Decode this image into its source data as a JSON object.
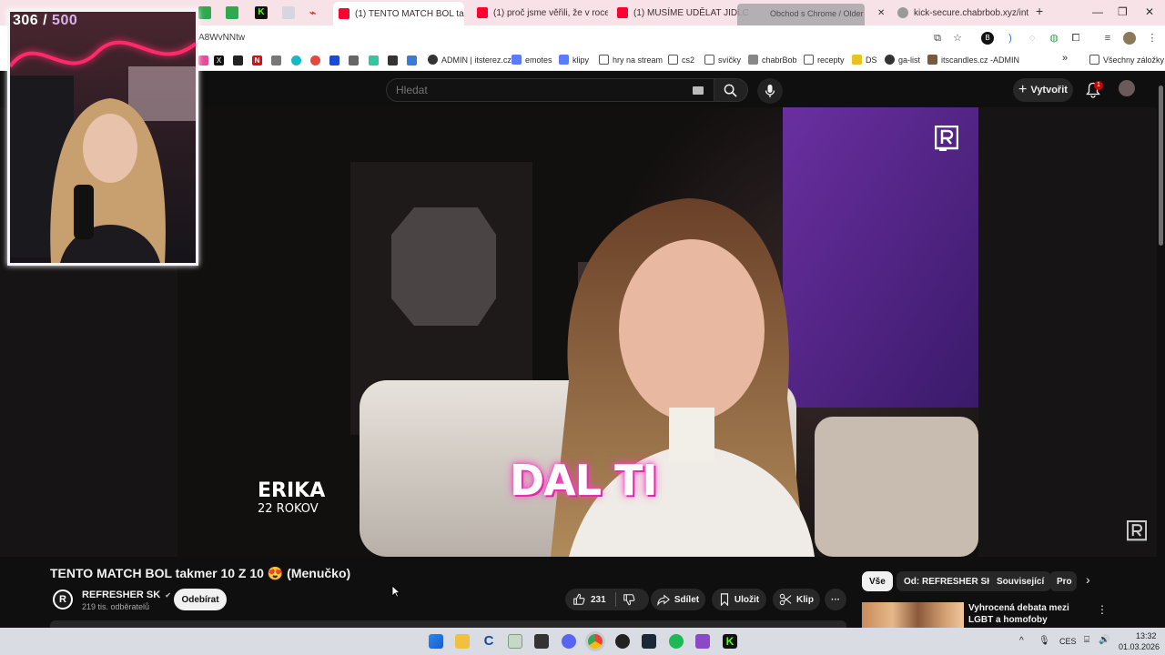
{
  "browser": {
    "tabs": [
      {
        "label": "",
        "color": "#2fa84f"
      },
      {
        "label": "",
        "color": "#2fa84f"
      },
      {
        "label": "",
        "color": "#53fc18"
      },
      {
        "label": "",
        "color": "#b8b8c8"
      },
      {
        "label": "",
        "color": "#d43a3a"
      },
      {
        "label": "(1) TENTO MATCH BOL ta",
        "color": "#ff0033"
      },
      {
        "label": "(1) proč jsme věřili, že v roce",
        "color": "#ff0033"
      },
      {
        "label": "(1) MUSÍME UDĚLAT JIDLO N",
        "color": "#ff0033"
      },
      {
        "label": "Obchod",
        "color": "#888888"
      },
      {
        "label": "kick-secure.chabrbob.xyz/int",
        "color": "#9a9a9a"
      }
    ],
    "tooltip": "Obchod s Chrome / Older a Helo",
    "url": "A8WvNNtw",
    "bookmarks": [
      {
        "label": "ADMIN | itsterez.cz",
        "color": "#333333"
      },
      {
        "label": "emotes",
        "color": "#5b7cfa"
      },
      {
        "label": "klipy",
        "color": "#5b7cfa"
      },
      {
        "label": "hry na stream",
        "color": "#555555"
      },
      {
        "label": "cs2",
        "color": "#555555"
      },
      {
        "label": "svíčky",
        "color": "#555555"
      },
      {
        "label": "chabrBob",
        "color": "#333333"
      },
      {
        "label": "recepty",
        "color": "#555555"
      },
      {
        "label": "DS",
        "color": "#e8c31a"
      },
      {
        "label": "ga-list",
        "color": "#333333"
      },
      {
        "label": "itscandles.cz -ADMIN",
        "color": "#7a5a3a"
      }
    ],
    "all_bookmarks": "Všechny záložky",
    "more_bookmarks": "»"
  },
  "youtube": {
    "search_placeholder": "Hledat",
    "create_label": "Vytvořit",
    "notification_count": "1"
  },
  "stream_overlay": {
    "count": "306",
    "separator": " / ",
    "total": "500"
  },
  "video": {
    "subtitle": "DAL TI",
    "name": "ERIKA",
    "age": "22 ROKOV",
    "title": "TENTO MATCH BOL takmer 10 Z 10 😍 (Menučko)"
  },
  "channel": {
    "name": "REFRESHER SK",
    "verified": "✔",
    "subscribers": "219 tis. odběratelů",
    "subscribe_label": "Odebírat",
    "avatar_letter": "R"
  },
  "actions": {
    "likes": "231",
    "share": "Sdílet",
    "save": "Uložit",
    "clip": "Klip",
    "more": "···"
  },
  "chips": [
    "Vše",
    "Od: REFRESHER SK",
    "Související",
    "Pro"
  ],
  "recommendation": {
    "title": "Vyhrocená debata mezi LGBT a homofoby"
  },
  "system": {
    "lang": "CES",
    "time": "13:32",
    "date": "01.03.2026",
    "tray_up": "^"
  },
  "colors": {
    "accent_red": "#ff0033",
    "neon_pink": "#ff3fc0",
    "counter_purple": "#d8b4e8"
  }
}
